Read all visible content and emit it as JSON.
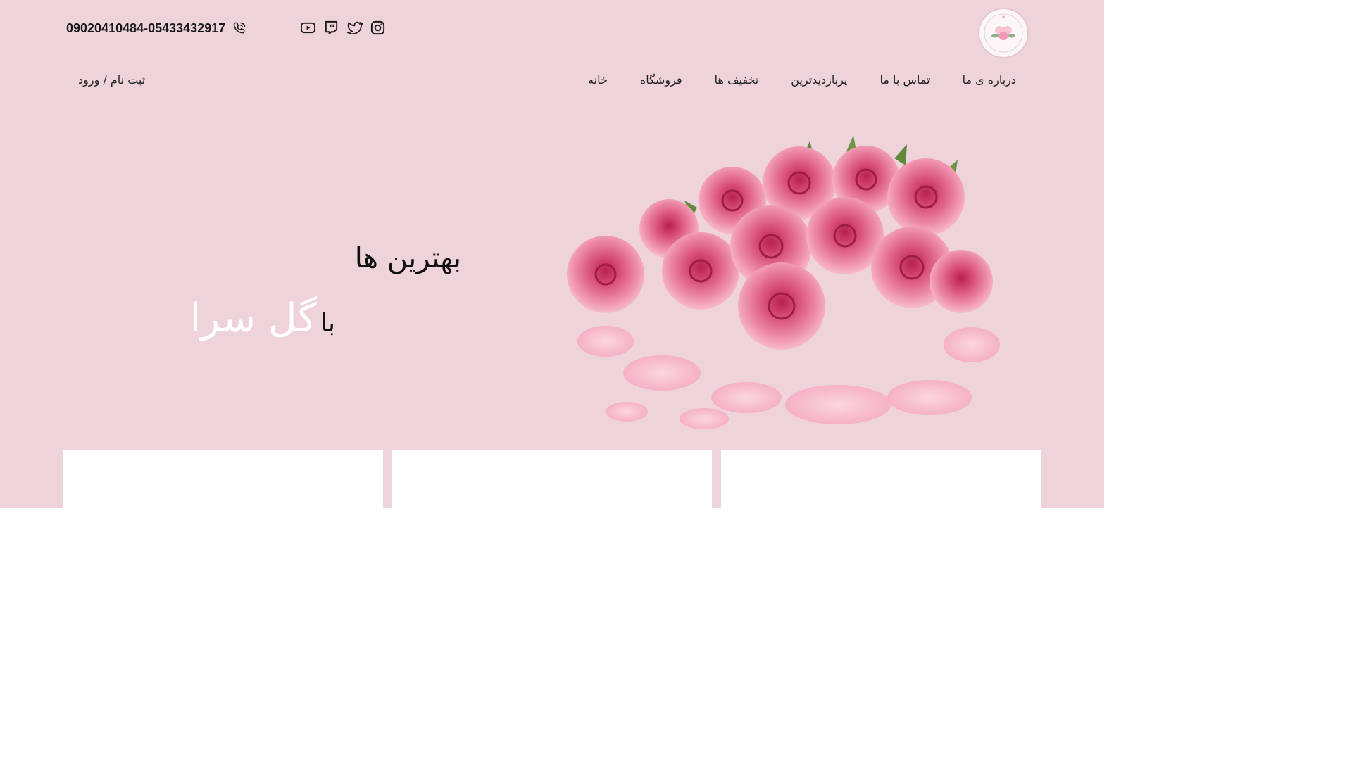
{
  "header": {
    "phone": "09020410484-05433432917",
    "social": [
      "instagram-icon",
      "twitter-icon",
      "twitch-icon",
      "youtube-icon"
    ]
  },
  "nav": {
    "items": [
      "خانه",
      "فروشگاه",
      "تخفیف ها",
      "پربازدیدترین",
      "تماس با ما",
      "درباره ی ما"
    ],
    "auth": "ثبت نام / ورود"
  },
  "hero": {
    "line1": "بهترین ها",
    "line2_prefix": "با",
    "brand": "گل سرا"
  },
  "colors": {
    "background": "#efd3da",
    "text": "#111111",
    "brand": "#ffffff",
    "rose": "#e0648a"
  }
}
